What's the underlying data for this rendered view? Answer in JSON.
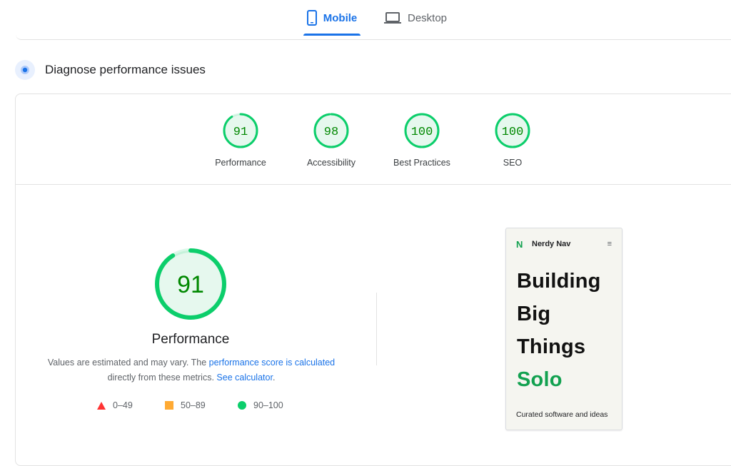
{
  "tabs": [
    {
      "label": "Mobile",
      "icon": "phone-icon",
      "active": true
    },
    {
      "label": "Desktop",
      "icon": "laptop-icon",
      "active": false
    }
  ],
  "diagnose": {
    "title": "Diagnose performance issues"
  },
  "categories": [
    {
      "score": "91",
      "label": "Performance",
      "fraction": 0.91
    },
    {
      "score": "98",
      "label": "Accessibility",
      "fraction": 0.98
    },
    {
      "score": "100",
      "label": "Best Practices",
      "fraction": 1.0
    },
    {
      "score": "100",
      "label": "SEO",
      "fraction": 1.0
    }
  ],
  "performance": {
    "score": "91",
    "fraction": 0.91,
    "title": "Performance",
    "desc_1": "Values are estimated and may vary. The ",
    "link_1": "performance score is calculated",
    "desc_2": "directly from these metrics. ",
    "link_2": "See calculator",
    "desc_3": "."
  },
  "legend": [
    {
      "range": "0–49",
      "shape": "triangle",
      "color": "#ff3333"
    },
    {
      "range": "50–89",
      "shape": "square",
      "color": "#ffaa33"
    },
    {
      "range": "90–100",
      "shape": "circle",
      "color": "#0cce6b"
    }
  ],
  "colors": {
    "pass": "#0cce6b",
    "pass_text": "#008800",
    "pass_bg": "#e6f8ee",
    "accent": "#1a73e8"
  },
  "thumbnail": {
    "logo": "N",
    "brand": "Nerdy Nav",
    "menu": "≡",
    "lines": [
      "Building",
      "Big",
      "Things",
      "Solo"
    ],
    "tagline": "Curated software and ideas"
  }
}
